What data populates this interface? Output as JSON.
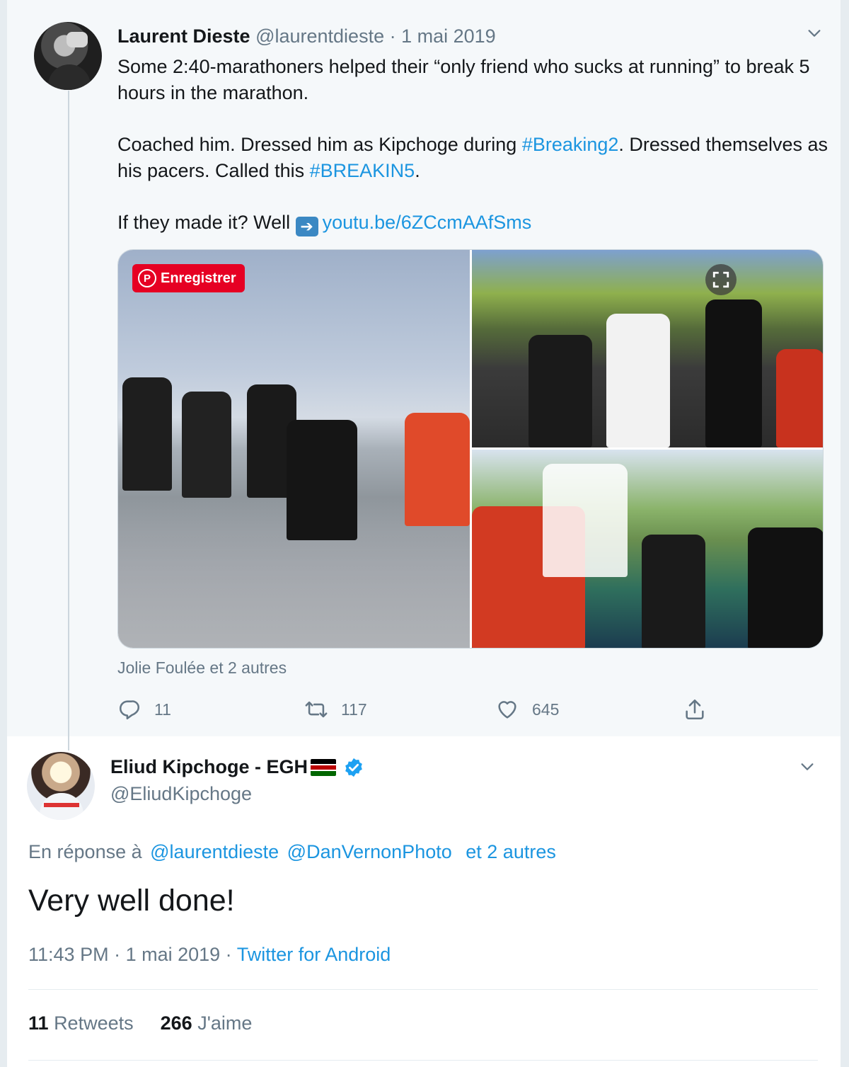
{
  "parent_tweet": {
    "author_name": "Laurent Dieste",
    "author_handle": "@laurentdieste",
    "separator": " · ",
    "date": "1 mai 2019",
    "text_para1": "Some 2:40-marathoners helped their “only friend who sucks at running” to break 5 hours in the marathon.",
    "text_para2_a": "Coached him. Dressed him as Kipchoge during ",
    "hashtag1": "#Breaking2",
    "text_para2_b": ". Dressed themselves as his pacers. Called this ",
    "hashtag2": "#BREAKIN5",
    "text_para2_c": ".",
    "text_para3": "If they made it? Well ",
    "link": "youtu.be/6ZCcmAAfSms",
    "pinterest_label": "Enregistrer",
    "likers": "Jolie Foulée et 2 autres",
    "replies": "11",
    "retweets": "117",
    "likes": "645"
  },
  "reply_tweet": {
    "author_name": "Eliud Kipchoge - EGH",
    "author_handle": "@EliudKipchoge",
    "reply_prefix": "En réponse à",
    "reply_mention1": "@laurentdieste",
    "reply_mention2": "@DanVernonPhoto",
    "reply_others": "et 2 autres",
    "text": "Very well done!",
    "time": "11:43 PM",
    "separator": " · ",
    "date": "1 mai 2019",
    "source": "Twitter for Android",
    "retweets_count": "11",
    "retweets_label": "Retweets",
    "likes_count": "266",
    "likes_label": "J'aime"
  },
  "colors": {
    "link": "#1b95e0",
    "secondary_text": "#657786",
    "primary_text": "#14171a",
    "pinterest": "#e60023"
  },
  "icons": [
    "chevron-down-icon",
    "pinterest-icon",
    "expand-icon",
    "reply-icon",
    "retweet-icon",
    "heart-icon",
    "share-icon",
    "verified-badge-icon",
    "kenya-flag-icon",
    "right-arrow-emoji"
  ]
}
